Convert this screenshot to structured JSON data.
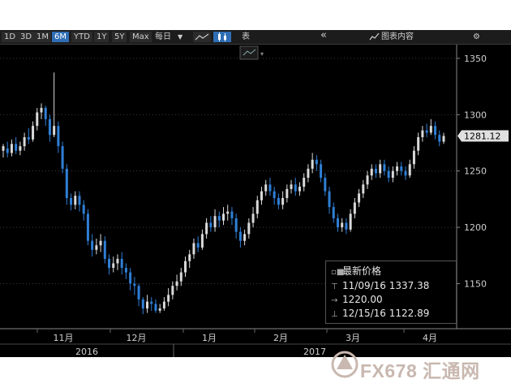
{
  "toolbar": {
    "ranges": [
      "1D",
      "3D",
      "1M",
      "6M",
      "YTD",
      "1Y",
      "5Y",
      "Max"
    ],
    "active_range": "6M",
    "period_label": "每日",
    "period_caret": "▼",
    "table_label": "表",
    "collapse_glyph": "«",
    "chart_content_label": "图表内容",
    "settings_glyph": "⚙"
  },
  "chart_data": {
    "type": "candlestick",
    "ylim": [
      1100,
      1360
    ],
    "yticks": [
      1150,
      1200,
      1250,
      1300,
      1350
    ],
    "xticks": [
      "11月",
      "12月",
      "1月",
      "2月",
      "3月",
      "4月"
    ],
    "years": [
      "2016",
      "2017"
    ],
    "last_price": "1281.12",
    "candles": [
      [
        1268,
        1272,
        1274,
        1262
      ],
      [
        1270,
        1266,
        1276,
        1262
      ],
      [
        1266,
        1274,
        1278,
        1263
      ],
      [
        1274,
        1268,
        1280,
        1265
      ],
      [
        1268,
        1272,
        1276,
        1264
      ],
      [
        1272,
        1280,
        1284,
        1268
      ],
      [
        1280,
        1278,
        1288,
        1274
      ],
      [
        1278,
        1290,
        1294,
        1276
      ],
      [
        1290,
        1302,
        1306,
        1286
      ],
      [
        1302,
        1306,
        1310,
        1296
      ],
      [
        1306,
        1296,
        1308,
        1290
      ],
      [
        1296,
        1282,
        1300,
        1276
      ],
      [
        1282,
        1290,
        1337.38,
        1280
      ],
      [
        1290,
        1272,
        1294,
        1266
      ],
      [
        1272,
        1252,
        1276,
        1248
      ],
      [
        1252,
        1226,
        1256,
        1220
      ],
      [
        1226,
        1220,
        1230,
        1215
      ],
      [
        1220,
        1228,
        1232,
        1216
      ],
      [
        1228,
        1220,
        1232,
        1214
      ],
      [
        1220,
        1212,
        1224,
        1206
      ],
      [
        1212,
        1188,
        1216,
        1184
      ],
      [
        1188,
        1180,
        1194,
        1174
      ],
      [
        1180,
        1184,
        1190,
        1176
      ],
      [
        1184,
        1188,
        1194,
        1178
      ],
      [
        1188,
        1172,
        1192,
        1168
      ],
      [
        1172,
        1164,
        1176,
        1158
      ],
      [
        1164,
        1168,
        1174,
        1160
      ],
      [
        1168,
        1172,
        1176,
        1162
      ],
      [
        1172,
        1164,
        1178,
        1158
      ],
      [
        1164,
        1160,
        1168,
        1154
      ],
      [
        1160,
        1150,
        1164,
        1144
      ],
      [
        1150,
        1148,
        1156,
        1140
      ],
      [
        1148,
        1136,
        1150,
        1130
      ],
      [
        1136,
        1128,
        1138,
        1122.89
      ],
      [
        1128,
        1134,
        1140,
        1124
      ],
      [
        1134,
        1132,
        1138,
        1126
      ],
      [
        1132,
        1126,
        1136,
        1124
      ],
      [
        1126,
        1128,
        1132,
        1124
      ],
      [
        1128,
        1134,
        1138,
        1126
      ],
      [
        1134,
        1140,
        1146,
        1130
      ],
      [
        1140,
        1148,
        1152,
        1136
      ],
      [
        1148,
        1152,
        1158,
        1144
      ],
      [
        1152,
        1160,
        1164,
        1148
      ],
      [
        1160,
        1170,
        1174,
        1156
      ],
      [
        1170,
        1176,
        1180,
        1164
      ],
      [
        1176,
        1186,
        1190,
        1172
      ],
      [
        1186,
        1182,
        1192,
        1178
      ],
      [
        1182,
        1194,
        1198,
        1180
      ],
      [
        1194,
        1204,
        1208,
        1190
      ],
      [
        1204,
        1200,
        1210,
        1196
      ],
      [
        1200,
        1210,
        1216,
        1196
      ],
      [
        1210,
        1206,
        1214,
        1200
      ],
      [
        1206,
        1212,
        1218,
        1202
      ],
      [
        1212,
        1214,
        1220,
        1206
      ],
      [
        1214,
        1208,
        1218,
        1202
      ],
      [
        1208,
        1196,
        1212,
        1190
      ],
      [
        1196,
        1188,
        1200,
        1182
      ],
      [
        1188,
        1194,
        1198,
        1184
      ],
      [
        1194,
        1204,
        1208,
        1190
      ],
      [
        1204,
        1212,
        1218,
        1200
      ],
      [
        1212,
        1224,
        1228,
        1208
      ],
      [
        1224,
        1232,
        1236,
        1220
      ],
      [
        1232,
        1238,
        1242,
        1228
      ],
      [
        1238,
        1232,
        1244,
        1228
      ],
      [
        1232,
        1226,
        1236,
        1220
      ],
      [
        1226,
        1220,
        1230,
        1216
      ],
      [
        1220,
        1226,
        1232,
        1216
      ],
      [
        1226,
        1234,
        1238,
        1222
      ],
      [
        1234,
        1238,
        1242,
        1230
      ],
      [
        1238,
        1232,
        1244,
        1228
      ],
      [
        1232,
        1236,
        1240,
        1228
      ],
      [
        1236,
        1244,
        1248,
        1232
      ],
      [
        1244,
        1252,
        1256,
        1240
      ],
      [
        1252,
        1260,
        1266,
        1248
      ],
      [
        1260,
        1256,
        1264,
        1250
      ],
      [
        1256,
        1244,
        1260,
        1240
      ],
      [
        1244,
        1232,
        1248,
        1228
      ],
      [
        1232,
        1218,
        1236,
        1212
      ],
      [
        1218,
        1208,
        1222,
        1204
      ],
      [
        1208,
        1200,
        1212,
        1196
      ],
      [
        1200,
        1204,
        1208,
        1196
      ],
      [
        1204,
        1198,
        1208,
        1194
      ],
      [
        1198,
        1212,
        1216,
        1196
      ],
      [
        1212,
        1222,
        1226,
        1208
      ],
      [
        1222,
        1230,
        1234,
        1218
      ],
      [
        1230,
        1238,
        1242,
        1226
      ],
      [
        1238,
        1246,
        1250,
        1234
      ],
      [
        1246,
        1252,
        1256,
        1242
      ],
      [
        1252,
        1248,
        1256,
        1244
      ],
      [
        1248,
        1256,
        1260,
        1244
      ],
      [
        1256,
        1250,
        1260,
        1246
      ],
      [
        1250,
        1244,
        1254,
        1240
      ],
      [
        1244,
        1250,
        1254,
        1240
      ],
      [
        1250,
        1254,
        1258,
        1246
      ],
      [
        1254,
        1250,
        1258,
        1246
      ],
      [
        1250,
        1246,
        1254,
        1242
      ],
      [
        1246,
        1256,
        1260,
        1244
      ],
      [
        1256,
        1268,
        1272,
        1252
      ],
      [
        1268,
        1280,
        1284,
        1264
      ],
      [
        1280,
        1286,
        1290,
        1276
      ],
      [
        1286,
        1284,
        1292,
        1280
      ],
      [
        1284,
        1290,
        1296,
        1282
      ],
      [
        1290,
        1282,
        1294,
        1278
      ],
      [
        1282,
        1276,
        1286,
        1272
      ],
      [
        1276,
        1281.12,
        1284,
        1274
      ]
    ]
  },
  "legend": {
    "title": "最新价格",
    "high_date": "11/09/16",
    "high_value": "1337.38",
    "mid_value": "1220.00",
    "low_date": "12/15/16",
    "low_value": "1122.89"
  },
  "watermark": {
    "text": "FX678 汇通网"
  },
  "colors": {
    "up": "#d9d9d9",
    "down": "#2f7fd6",
    "background": "#000000",
    "grid": "#3a3a3a",
    "text": "#cfcfcf"
  }
}
